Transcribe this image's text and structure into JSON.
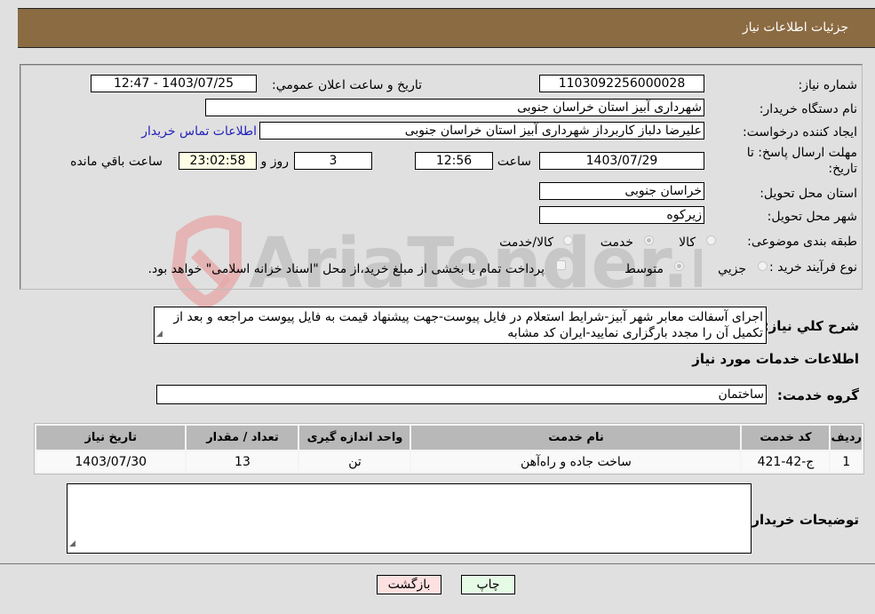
{
  "header": {
    "title": "جزئیات اطلاعات نیاز"
  },
  "form": {
    "need_number": {
      "label": "شماره نیاز:",
      "value": "1103092256000028"
    },
    "announce_datetime": {
      "label": "تاریخ و ساعت اعلان عمومي:",
      "value": "1403/07/25 - 12:47"
    },
    "buyer_org": {
      "label": "نام دستگاه خریدار:",
      "value": "شهرداری آبیز استان خراسان جنوبی"
    },
    "requester": {
      "label": "ایجاد کننده درخواست:",
      "value": "علیرضا دلباز کاربرداز شهرداری آبیز استان خراسان جنوبی"
    },
    "buyer_contact_link": "اطلاعات تماس خریدار",
    "deadline": {
      "label_line1": "مهلت ارسال پاسخ: تا",
      "label_line2": "تاریخ:",
      "date": "1403/07/29",
      "time_label": "ساعت",
      "time": "12:56",
      "days": "3",
      "days_label": "روز و",
      "remaining": "23:02:58",
      "remaining_label": "ساعت باقي مانده"
    },
    "delivery_province": {
      "label": "استان محل تحویل:",
      "value": "خراسان جنوبی"
    },
    "delivery_city": {
      "label": "شهر محل تحویل:",
      "value": "زیرکوه"
    },
    "category": {
      "label": "طبقه بندی موضوعی:",
      "options": [
        "کالا",
        "خدمت",
        "کالا/خدمت"
      ],
      "selected": "خدمت"
    },
    "purchase_type": {
      "label": "نوع فرآیند خرید :",
      "options": [
        "جزيي",
        "متوسط"
      ],
      "selected": "متوسط",
      "treasury_note": "پرداخت تمام یا بخشی از مبلغ خرید،از محل \"اسناد خزانه اسلامی\" خواهد بود."
    }
  },
  "description": {
    "label": "شرح كلي نياز:",
    "value": "اجرای آسفالت معابر شهر آبیز-شرایط استعلام در فایل پیوست-جهت پیشنهاد قیمت به فایل پیوست مراجعه و بعد از تکمیل آن را مجدد بارگزاری نمایید-ایران کد مشابه"
  },
  "services_section": {
    "title": "اطلاعات خدمات مورد نياز",
    "group_label": "گروه خدمت:",
    "group_value": "ساختمان",
    "table": {
      "headers": [
        "رديف",
        "کد خدمت",
        "نام خدمت",
        "واحد اندازه گیری",
        "تعداد / مقدار",
        "تاریخ نیاز"
      ],
      "rows": [
        [
          "1",
          "ج-42-421",
          "ساخت جاده و راه‌آهن",
          "تن",
          "13",
          "1403/07/30"
        ]
      ]
    }
  },
  "buyer_notes": {
    "label": "توضیحات خریدار:",
    "value": ""
  },
  "buttons": {
    "print": "چاپ",
    "back": "بازگشت"
  },
  "watermark": {
    "text": "AriaTender.neT"
  }
}
